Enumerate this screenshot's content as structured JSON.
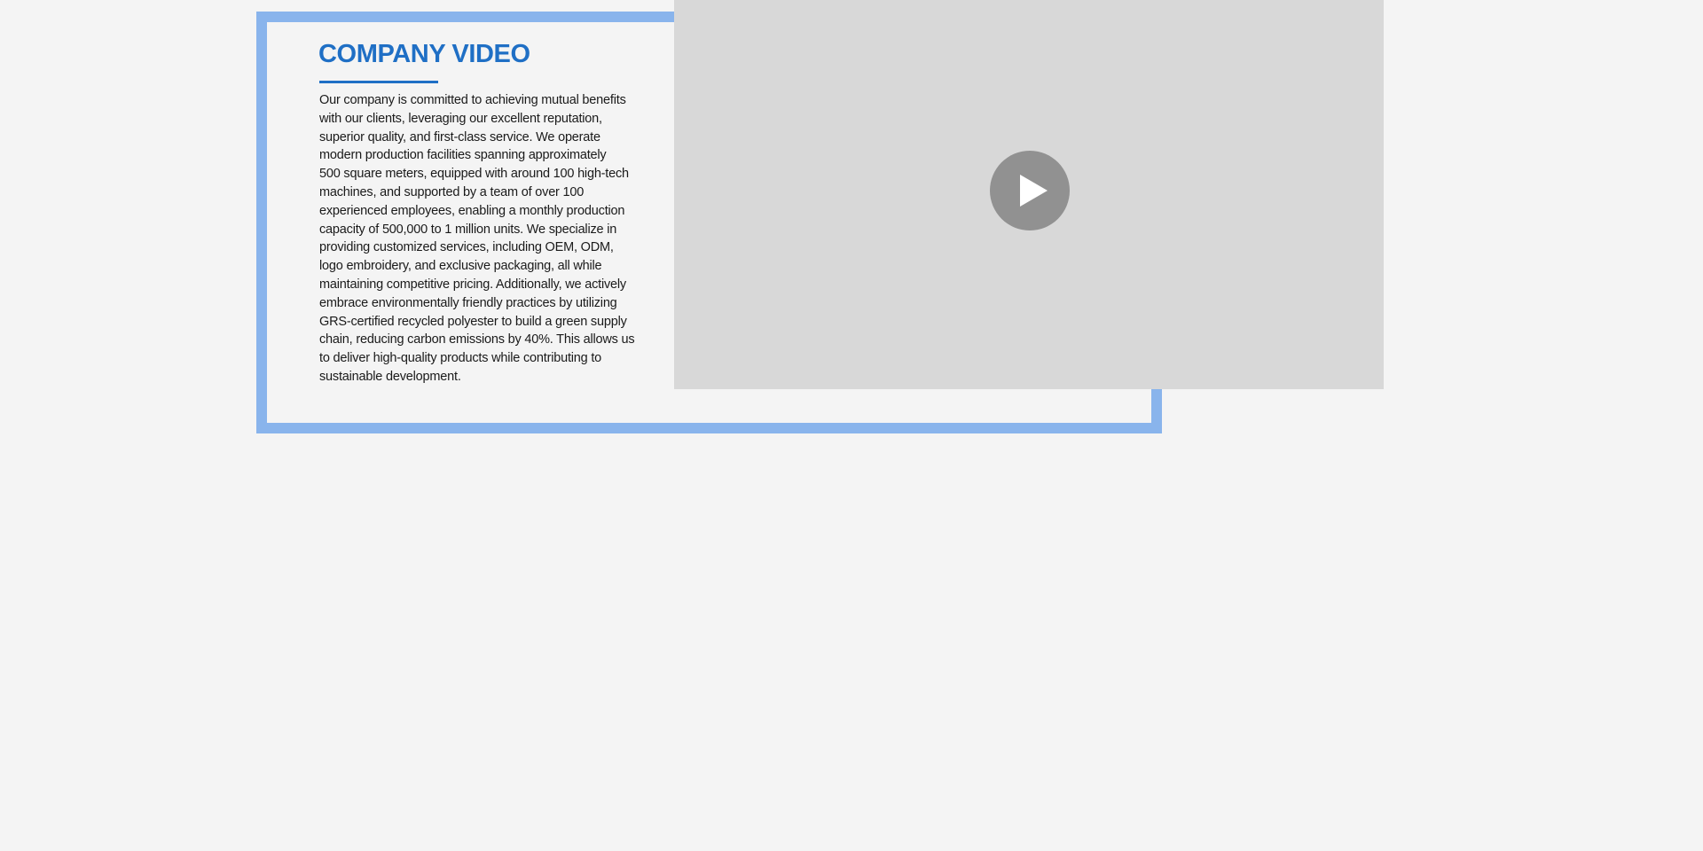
{
  "section": {
    "title": "COMPANY VIDEO",
    "description_lines": [
      "Our company is committed to achieving mutual benefits",
      "with our clients, leveraging our excellent reputation,",
      "superior quality, and first-class service. We operate",
      "modern production facilities spanning approximately",
      "500 square meters, equipped with around 100 high-tech",
      "machines, and supported by a team of over 100",
      "experienced employees, enabling a monthly production",
      "capacity of 500,000 to 1 million units. We specialize in",
      "providing customized services, including OEM, ODM,",
      "logo embroidery, and exclusive packaging, all while",
      "maintaining competitive pricing. Additionally, we actively",
      "embrace environmentally friendly practices by utilizing",
      "GRS-certified recycled polyester to build a green supply",
      "chain, reducing carbon emissions by 40%. This allows us",
      "to deliver high-quality products while contributing to",
      "sustainable development."
    ]
  },
  "video": {
    "play_icon": "play-icon"
  },
  "colors": {
    "page_background": "#f4f4f4",
    "frame_border": "#89b4ec",
    "title_accent": "#1f6fc5",
    "body_text": "#1a1a1a",
    "video_background": "#d8d8d8",
    "play_button": "#919191",
    "play_glyph": "#ffffff"
  }
}
